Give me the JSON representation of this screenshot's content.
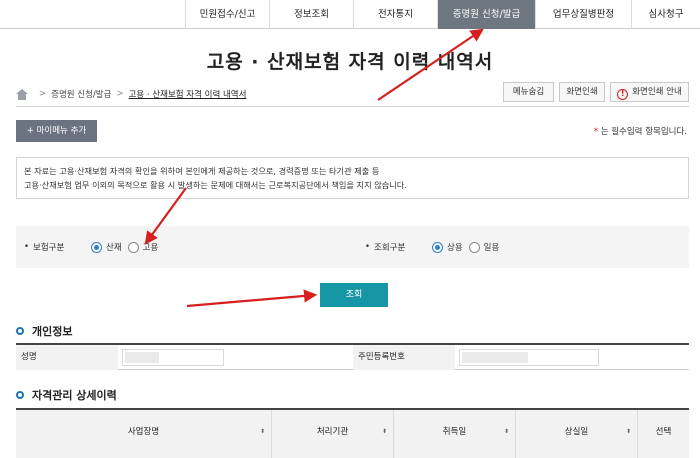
{
  "topnav": {
    "items": [
      "민원접수/신고",
      "정보조회",
      "전자통지",
      "증명원 신청/발급",
      "업무상질병판정",
      "심사청구"
    ],
    "active_index": 3
  },
  "page": {
    "title": "고용 · 산재보험 자격 이력 내역서"
  },
  "breadcrumb": {
    "items": [
      "증명원 신청/발급",
      "고용 · 산재보험 자격 이력 내역서"
    ]
  },
  "toolbar": {
    "menu_hide": "메뉴숨김",
    "print": "화면인쇄",
    "print_guide": "화면인쇄 안내"
  },
  "mymenu": {
    "label": "+ 마이메뉴 추가"
  },
  "required_note": {
    "star": "*",
    "text": "는 필수입력 항목입니다."
  },
  "notice": {
    "line1": "본 자료는 고용·산재보험 자격의 확인을 위하여 본인에게 제공하는 것으로, 경력증명 또는 타기관 제출 등",
    "line2": "고용·산재보험 업무 이외의 목적으로 활용 시 발생하는 문제에 대해서는 근로복지공단에서 책임을 지지 않습니다."
  },
  "search": {
    "insurance_type": {
      "label": "보험구분",
      "options": [
        "산재",
        "고용"
      ],
      "selected": "산재"
    },
    "query_type": {
      "label": "조회구분",
      "options": [
        "상용",
        "일용"
      ],
      "selected": "상용"
    },
    "button": "조회"
  },
  "personal": {
    "section_title": "개인정보",
    "name_label": "성명",
    "rrn_label": "주민등록번호"
  },
  "history": {
    "section_title": "자격관리 상세이력",
    "columns": [
      "사업장명",
      "처리기관",
      "취득일",
      "상실일",
      "선택"
    ],
    "sort_icon": "⬍"
  },
  "colors": {
    "active_tab": "#6e7680",
    "search_button": "#1796a6",
    "radio_selected": "#2d7fd3",
    "annotation_arrow": "#d61f1f"
  }
}
